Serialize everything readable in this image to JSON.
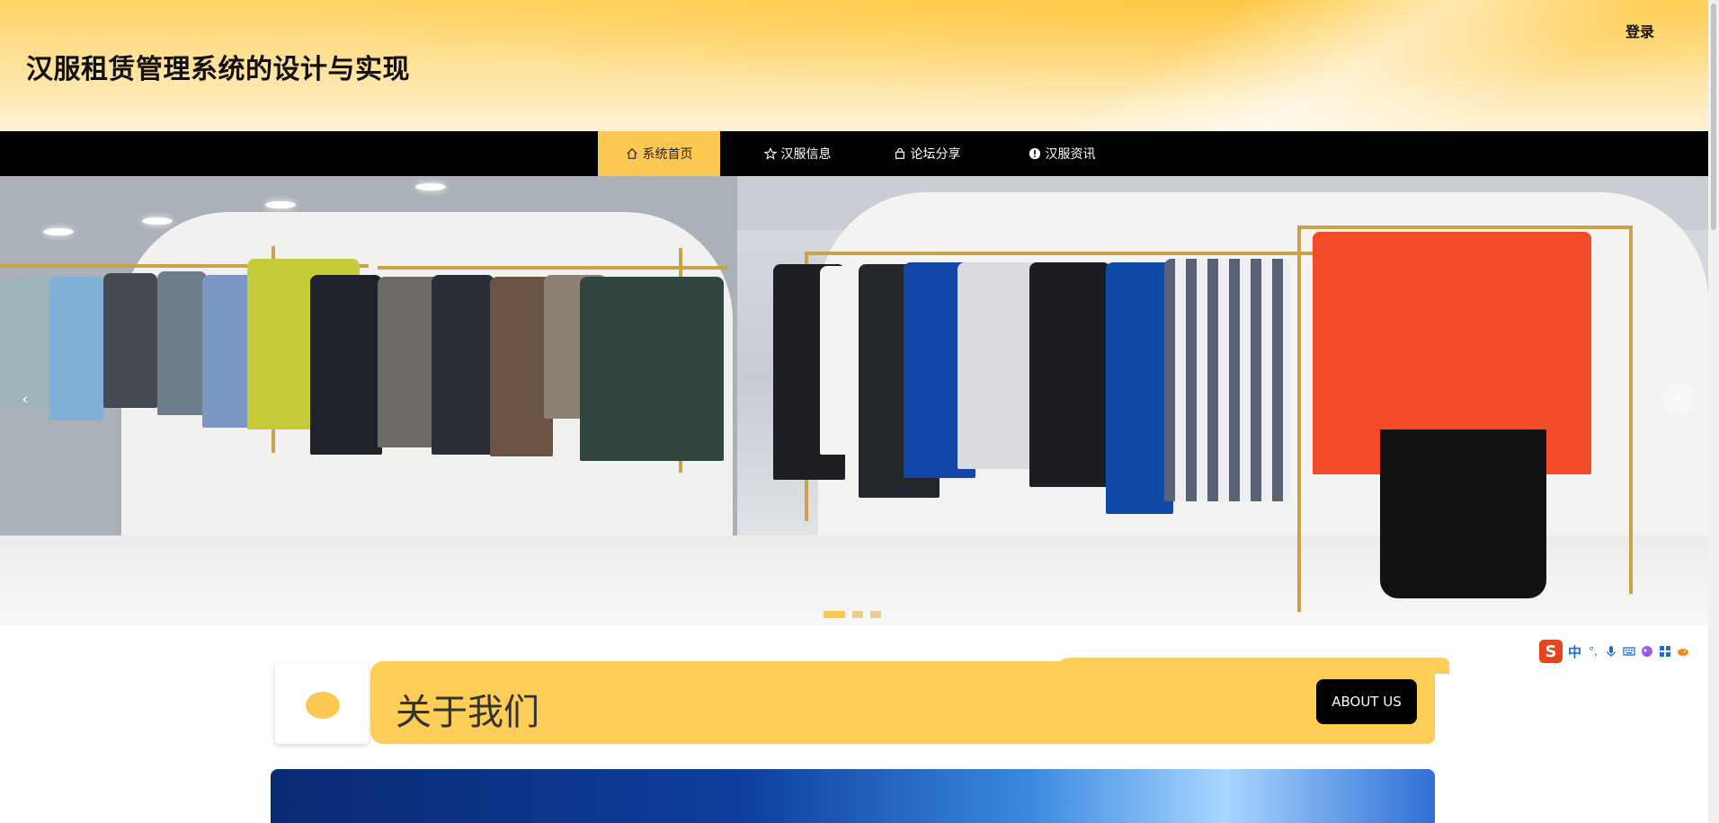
{
  "header": {
    "title": "汉服租赁管理系统的设计与实现",
    "login_label": "登录"
  },
  "nav": {
    "items": [
      {
        "label": "系统首页",
        "icon": "home-icon",
        "active": true
      },
      {
        "label": "汉服信息",
        "icon": "star-icon",
        "active": false
      },
      {
        "label": "论坛分享",
        "icon": "bag-icon",
        "active": false
      },
      {
        "label": "汉服资讯",
        "icon": "info-icon",
        "active": false
      }
    ]
  },
  "banner": {
    "prev_arrow": "‹",
    "next_arrow": "›",
    "slide_count": 3,
    "active_slide": 1
  },
  "about": {
    "title": "关于我们",
    "button_label": "ABOUT US"
  },
  "ime": {
    "logo": "S",
    "lang": "中",
    "punct": "°,"
  },
  "colors": {
    "accent": "#fcc851",
    "nav_bg": "#000000",
    "about_bar": "#fccd57"
  }
}
